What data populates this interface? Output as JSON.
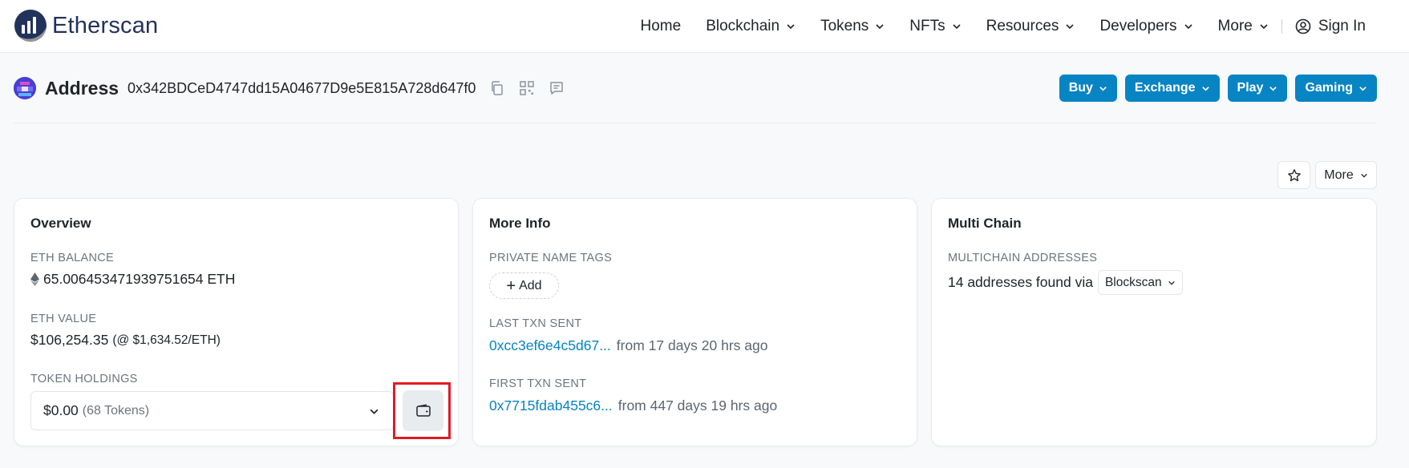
{
  "header": {
    "logo_text": "Etherscan",
    "nav": [
      {
        "label": "Home",
        "dropdown": false
      },
      {
        "label": "Blockchain",
        "dropdown": true
      },
      {
        "label": "Tokens",
        "dropdown": true
      },
      {
        "label": "NFTs",
        "dropdown": true
      },
      {
        "label": "Resources",
        "dropdown": true
      },
      {
        "label": "Developers",
        "dropdown": true
      },
      {
        "label": "More",
        "dropdown": true
      }
    ],
    "sign_in": "Sign In"
  },
  "address": {
    "title": "Address",
    "hash": "0x342BDCeD4747dd15A04677D9e5E815A728d647f0",
    "icons": [
      "copy-icon",
      "qr-code-icon",
      "note-icon"
    ]
  },
  "ad_buttons": [
    "Buy",
    "Exchange",
    "Play",
    "Gaming"
  ],
  "toolbar": {
    "more_label": "More",
    "star_icon": "star-icon"
  },
  "overview": {
    "title": "Overview",
    "eth_balance_label": "ETH BALANCE",
    "eth_balance_value": "65.006453471939751654 ETH",
    "eth_value_label": "ETH VALUE",
    "eth_value_value": "$106,254.35",
    "eth_value_rate": "(@ $1,634.52/ETH)",
    "token_holdings_label": "TOKEN HOLDINGS",
    "token_holdings_value": "$0.00",
    "token_holdings_count": "(68 Tokens)"
  },
  "more_info": {
    "title": "More Info",
    "private_tags_label": "PRIVATE NAME TAGS",
    "add_label": "Add",
    "last_txn_label": "LAST TXN SENT",
    "last_txn_hash": "0xcc3ef6e4c5d67...",
    "last_txn_time": "from 17 days 20 hrs ago",
    "first_txn_label": "FIRST TXN SENT",
    "first_txn_hash": "0x7715fdab455c6...",
    "first_txn_time": "from 447 days 19 hrs ago"
  },
  "multi_chain": {
    "title": "Multi Chain",
    "label": "MULTICHAIN ADDRESSES",
    "text": "14 addresses found via",
    "button": "Blockscan"
  },
  "colors": {
    "accent": "#0784c3",
    "brand": "#21325b",
    "highlight": "#e21b24"
  }
}
